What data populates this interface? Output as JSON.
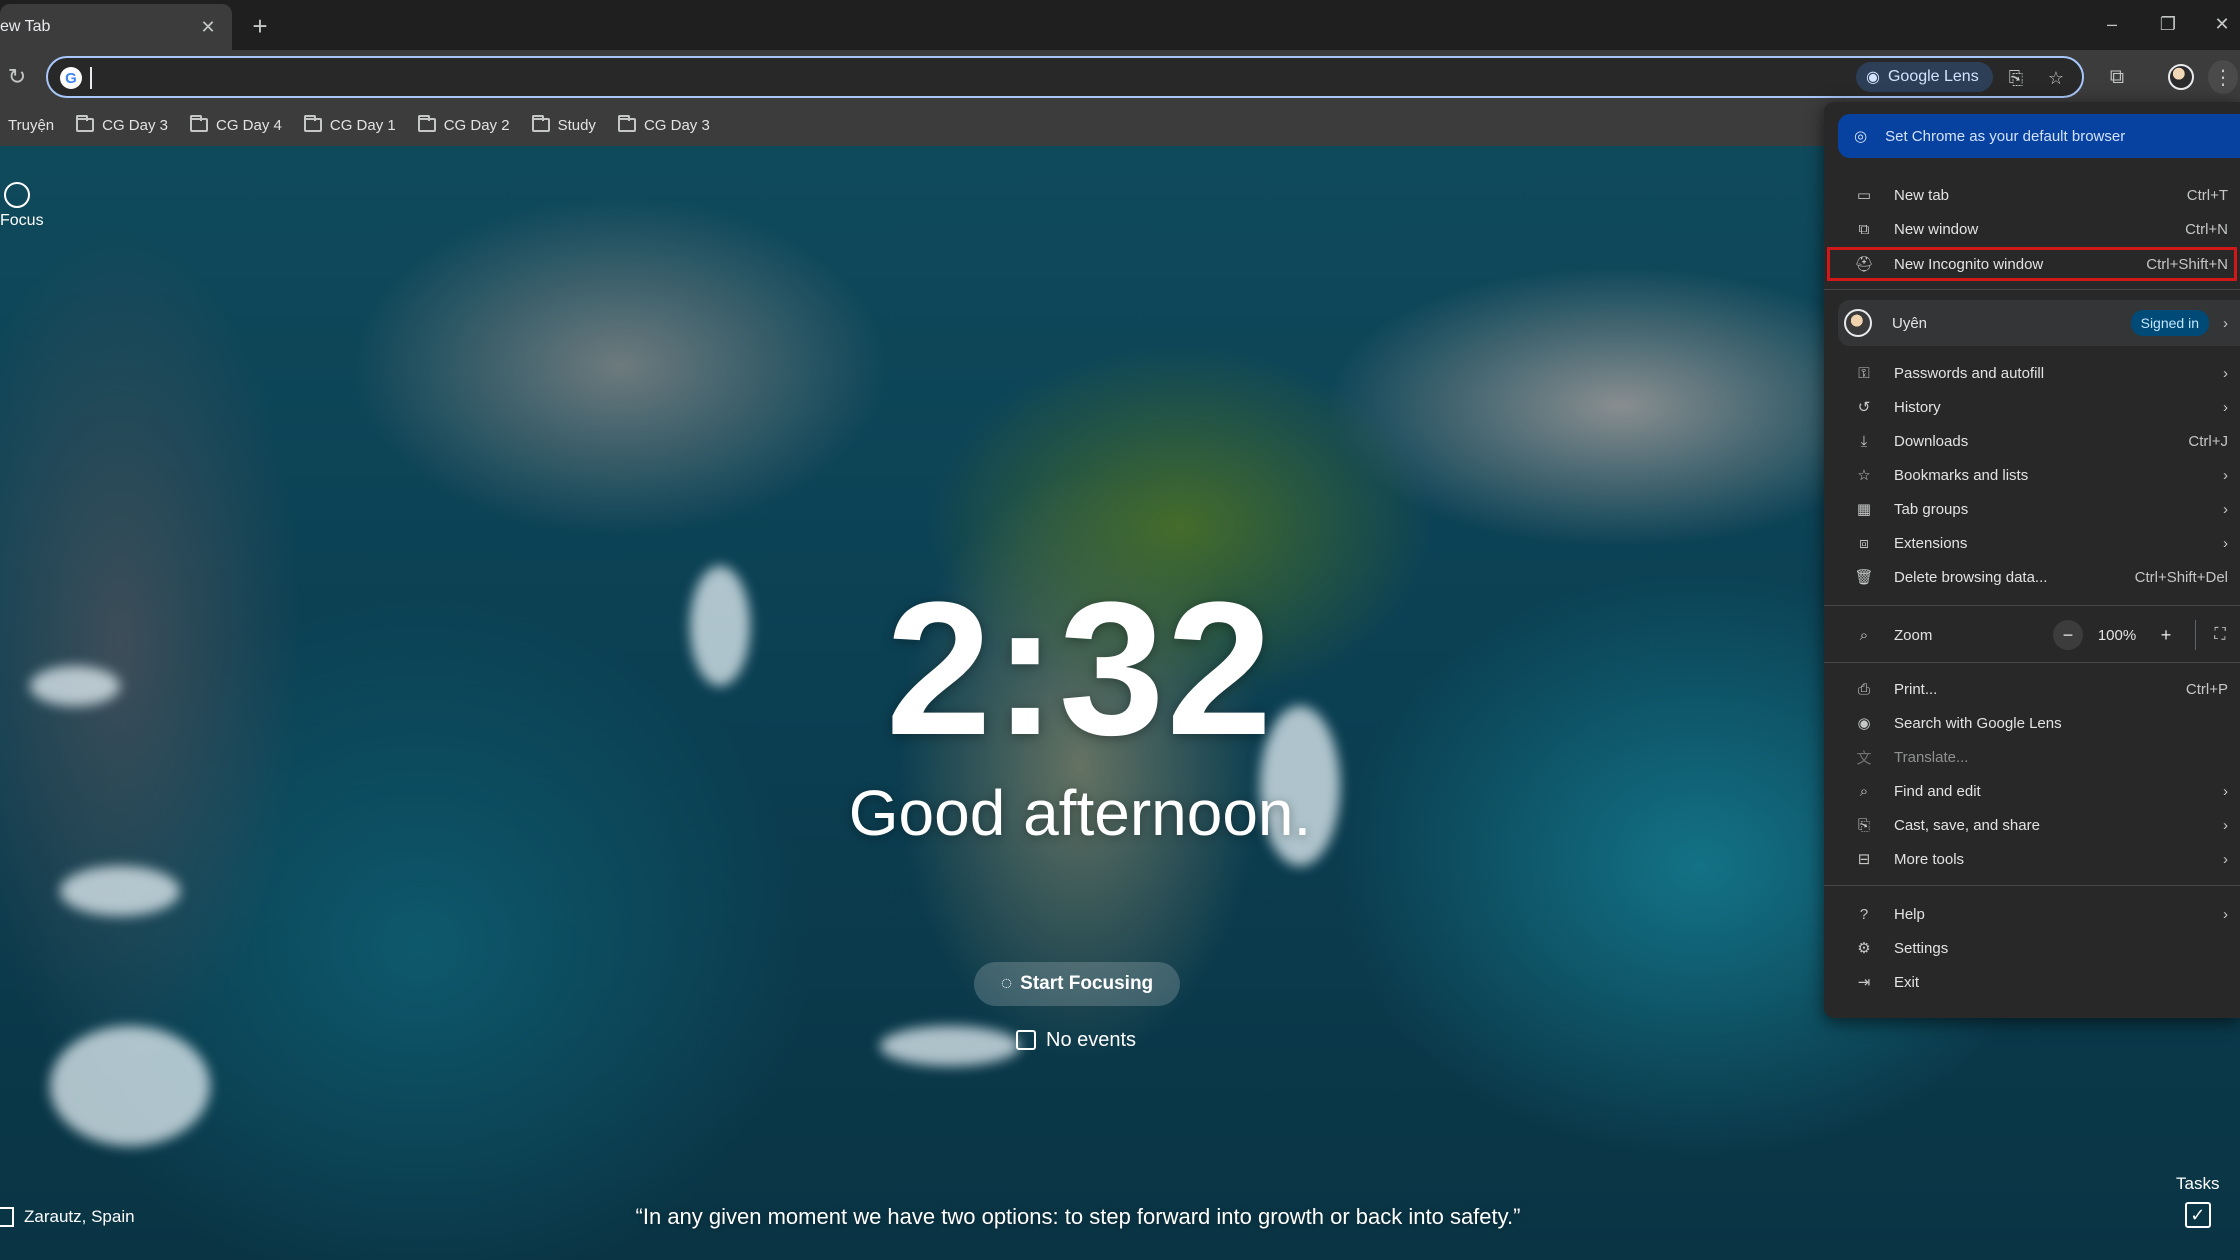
{
  "tab": {
    "title": "ew Tab",
    "close": "✕",
    "new_tab": "+"
  },
  "window_controls": {
    "minimize": "–",
    "restore": "❐",
    "close": "✕"
  },
  "toolbar": {
    "reload_icon": "reload-icon",
    "omnibox_value": "",
    "google_lens_label": "Google Lens"
  },
  "bookmarks": [
    {
      "label": "Truyện",
      "folder": false
    },
    {
      "label": "CG Day 3",
      "folder": true
    },
    {
      "label": "CG Day 4",
      "folder": true
    },
    {
      "label": "CG Day 1",
      "folder": true
    },
    {
      "label": "CG Day 2",
      "folder": true
    },
    {
      "label": "Study",
      "folder": true
    },
    {
      "label": "CG Day 3",
      "folder": true
    }
  ],
  "momentum": {
    "focus_label": "Focus",
    "time": "2:32",
    "greeting": "Good afternoon.",
    "start_focusing": "Start Focusing",
    "no_events": "No events",
    "location": "Zarautz, Spain",
    "quote": "“In any given moment we have two options: to step forward into growth or back into safety.”",
    "tasks_label": "Tasks"
  },
  "menu": {
    "default_browser": "Set Chrome as your default browser",
    "items_top": [
      {
        "label": "New tab",
        "shortcut": "Ctrl+T",
        "icon": "new-tab-icon"
      },
      {
        "label": "New window",
        "shortcut": "Ctrl+N",
        "icon": "new-window-icon"
      },
      {
        "label": "New Incognito window",
        "shortcut": "Ctrl+Shift+N",
        "icon": "incognito-icon"
      }
    ],
    "profile": {
      "name": "Uyên",
      "status": "Signed in"
    },
    "items_mid": [
      {
        "label": "Passwords and autofill",
        "shortcut": "",
        "submenu": true,
        "icon": "key-icon"
      },
      {
        "label": "History",
        "shortcut": "",
        "submenu": true,
        "icon": "history-icon"
      },
      {
        "label": "Downloads",
        "shortcut": "Ctrl+J",
        "submenu": false,
        "icon": "download-icon"
      },
      {
        "label": "Bookmarks and lists",
        "shortcut": "",
        "submenu": true,
        "icon": "star-icon"
      },
      {
        "label": "Tab groups",
        "shortcut": "",
        "submenu": true,
        "icon": "tab-groups-icon"
      },
      {
        "label": "Extensions",
        "shortcut": "",
        "submenu": true,
        "icon": "puzzle-icon"
      },
      {
        "label": "Delete browsing data...",
        "shortcut": "Ctrl+Shift+Del",
        "submenu": false,
        "icon": "trash-icon"
      }
    ],
    "zoom": {
      "label": "Zoom",
      "value": "100%",
      "minus": "−",
      "plus": "+"
    },
    "items_tools": [
      {
        "label": "Print...",
        "shortcut": "Ctrl+P",
        "submenu": false,
        "disabled": false,
        "icon": "print-icon"
      },
      {
        "label": "Search with Google Lens",
        "shortcut": "",
        "submenu": false,
        "disabled": false,
        "icon": "lens-icon"
      },
      {
        "label": "Translate...",
        "shortcut": "",
        "submenu": false,
        "disabled": true,
        "icon": "translate-icon"
      },
      {
        "label": "Find and edit",
        "shortcut": "",
        "submenu": true,
        "disabled": false,
        "icon": "find-icon"
      },
      {
        "label": "Cast, save, and share",
        "shortcut": "",
        "submenu": true,
        "disabled": false,
        "icon": "cast-icon"
      },
      {
        "label": "More tools",
        "shortcut": "",
        "submenu": true,
        "disabled": false,
        "icon": "toolbox-icon"
      }
    ],
    "items_bottom": [
      {
        "label": "Help",
        "submenu": true,
        "icon": "help-icon"
      },
      {
        "label": "Settings",
        "submenu": false,
        "icon": "gear-icon"
      },
      {
        "label": "Exit",
        "submenu": false,
        "icon": "exit-icon"
      }
    ]
  },
  "colors": {
    "menu_bg": "#282828",
    "banner_bg": "#0842a0",
    "highlight_border": "#d01818",
    "omnibox_focus": "#a8c7fa"
  }
}
